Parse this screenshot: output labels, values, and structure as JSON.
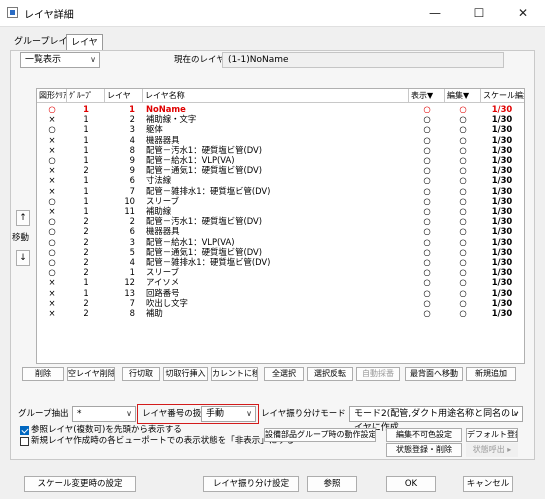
{
  "window": {
    "title": "レイヤ詳細",
    "minimize": "—",
    "maximize": "☐",
    "close": "✕"
  },
  "tabs": [
    "グループレイヤ",
    "レイヤ"
  ],
  "view_select": "一覧表示",
  "current_layer_label": "現在のレイヤ",
  "current_layer_value": "(1-1)NoName",
  "columns": [
    "図形ｸﾘｱ",
    "ｸﾞﾙｰﾌﾟ",
    "レイヤ",
    "レイヤ名称",
    "表示▼",
    "編集▼",
    "スケール編集"
  ],
  "rows": [
    {
      "f": "○",
      "g": "1",
      "l": "1",
      "n": "NoName",
      "d": "○",
      "e": "○",
      "s": "1/30",
      "red": true
    },
    {
      "f": "×",
      "g": "1",
      "l": "2",
      "n": "補助線・文字",
      "d": "○",
      "e": "○",
      "s": "1/30"
    },
    {
      "f": "○",
      "g": "1",
      "l": "3",
      "n": "躯体",
      "d": "○",
      "e": "○",
      "s": "1/30"
    },
    {
      "f": "×",
      "g": "1",
      "l": "4",
      "n": "機器器具",
      "d": "○",
      "e": "○",
      "s": "1/30"
    },
    {
      "f": "×",
      "g": "1",
      "l": "8",
      "n": "配管－汚水1：硬質塩ビ管(DV)",
      "d": "○",
      "e": "○",
      "s": "1/30"
    },
    {
      "f": "○",
      "g": "1",
      "l": "9",
      "n": "配管－給水1：VLP(VA)",
      "d": "○",
      "e": "○",
      "s": "1/30"
    },
    {
      "f": "×",
      "g": "2",
      "l": "9",
      "n": "配管－通気1：硬質塩ビ管(DV)",
      "d": "○",
      "e": "○",
      "s": "1/30"
    },
    {
      "f": "×",
      "g": "1",
      "l": "6",
      "n": "寸法線",
      "d": "○",
      "e": "○",
      "s": "1/30"
    },
    {
      "f": "×",
      "g": "1",
      "l": "7",
      "n": "配管－雑排水1：硬質塩ビ管(DV)",
      "d": "○",
      "e": "○",
      "s": "1/30"
    },
    {
      "f": "○",
      "g": "1",
      "l": "10",
      "n": "スリーブ",
      "d": "○",
      "e": "○",
      "s": "1/30"
    },
    {
      "f": "×",
      "g": "1",
      "l": "11",
      "n": "補助線",
      "d": "○",
      "e": "○",
      "s": "1/30"
    },
    {
      "f": "○",
      "g": "2",
      "l": "2",
      "n": "配管－汚水1：硬質塩ビ管(DV)",
      "d": "○",
      "e": "○",
      "s": "1/30"
    },
    {
      "f": "○",
      "g": "2",
      "l": "6",
      "n": "機器器具",
      "d": "○",
      "e": "○",
      "s": "1/30"
    },
    {
      "f": "○",
      "g": "2",
      "l": "3",
      "n": "配管－給水1：VLP(VA)",
      "d": "○",
      "e": "○",
      "s": "1/30"
    },
    {
      "f": "○",
      "g": "2",
      "l": "5",
      "n": "配管－通気1：硬質塩ビ管(DV)",
      "d": "○",
      "e": "○",
      "s": "1/30"
    },
    {
      "f": "○",
      "g": "2",
      "l": "4",
      "n": "配管－雑排水1：硬質塩ビ管(DV)",
      "d": "○",
      "e": "○",
      "s": "1/30"
    },
    {
      "f": "○",
      "g": "2",
      "l": "1",
      "n": "スリーブ",
      "d": "○",
      "e": "○",
      "s": "1/30"
    },
    {
      "f": "×",
      "g": "1",
      "l": "12",
      "n": "アイソメ",
      "d": "○",
      "e": "○",
      "s": "1/30"
    },
    {
      "f": "×",
      "g": "1",
      "l": "13",
      "n": "回路番号",
      "d": "○",
      "e": "○",
      "s": "1/30"
    },
    {
      "f": "×",
      "g": "2",
      "l": "7",
      "n": "吹出し文字",
      "d": "○",
      "e": "○",
      "s": "1/30"
    },
    {
      "f": "×",
      "g": "2",
      "l": "8",
      "n": "補助",
      "d": "○",
      "e": "○",
      "s": "1/30"
    }
  ],
  "move": {
    "up": "↑",
    "label": "移動",
    "down": "↓"
  },
  "buttons_row1": [
    "削除",
    "空レイヤ削除",
    "行切取",
    "切取行挿入",
    "カレントに移動",
    "全選択",
    "選択反転",
    "自動採番",
    "最背面へ移動",
    "新規追加"
  ],
  "group_extract_label": "グループ抽出",
  "group_extract_value": "*",
  "layer_number_label": "レイヤ番号の扱い",
  "layer_number_value": "手動",
  "layer_mode_label": "レイヤ振り分けモード",
  "layer_mode_value": "モード2(配管,ダクト用途名称と同名のレイヤに作成",
  "checkbox1": "参照レイヤ(複数可)を先頭から表示する",
  "checkbox2": "新規レイヤ作成時の各ビューポートでの表示状態を「非表示」にする",
  "btn_facility_group": "設備部品グループ時の動作設定",
  "btn_uneditable": "編集不可色設定",
  "btn_default_register": "デフォルト登録",
  "btn_state_register": "状態登録・削除",
  "btn_state_recall": "状態呼出 ▸",
  "footer": [
    "スケール変更時の設定",
    "レイヤ振り分け設定",
    "参照",
    "OK",
    "キャンセル"
  ]
}
